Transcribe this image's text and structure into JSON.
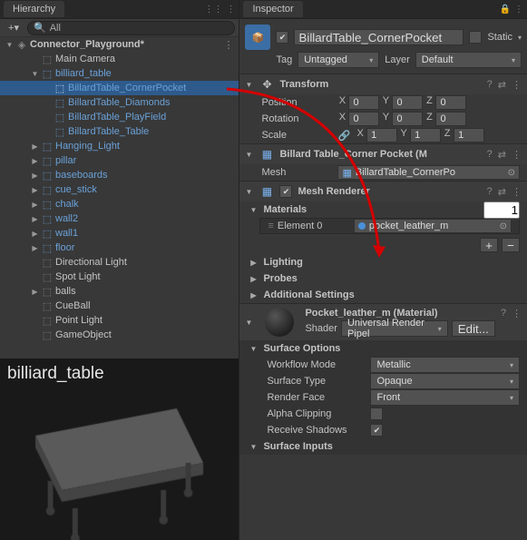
{
  "hierarchy": {
    "tab": "Hierarchy",
    "plus": "+",
    "searchPlaceholder": "All",
    "scene": {
      "name": "Connector_Playground*"
    },
    "nodes": [
      {
        "depth": 2,
        "label": "Main Camera",
        "blue": false,
        "fold": "none"
      },
      {
        "depth": 2,
        "label": "billiard_table",
        "blue": true,
        "fold": "open"
      },
      {
        "depth": 3,
        "label": "BillardTable_CornerPocket",
        "blue": true,
        "fold": "none",
        "sel": true
      },
      {
        "depth": 3,
        "label": "BillardTable_Diamonds",
        "blue": true,
        "fold": "none"
      },
      {
        "depth": 3,
        "label": "BillardTable_PlayField",
        "blue": true,
        "fold": "none"
      },
      {
        "depth": 3,
        "label": "BillardTable_Table",
        "blue": true,
        "fold": "none"
      },
      {
        "depth": 2,
        "label": "Hanging_Light",
        "blue": true,
        "fold": "closed"
      },
      {
        "depth": 2,
        "label": "pillar",
        "blue": true,
        "fold": "closed"
      },
      {
        "depth": 2,
        "label": "baseboards",
        "blue": true,
        "fold": "closed"
      },
      {
        "depth": 2,
        "label": "cue_stick",
        "blue": true,
        "fold": "closed"
      },
      {
        "depth": 2,
        "label": "chalk",
        "blue": true,
        "fold": "closed"
      },
      {
        "depth": 2,
        "label": "wall2",
        "blue": true,
        "fold": "closed"
      },
      {
        "depth": 2,
        "label": "wall1",
        "blue": true,
        "fold": "closed"
      },
      {
        "depth": 2,
        "label": "floor",
        "blue": true,
        "fold": "closed"
      },
      {
        "depth": 2,
        "label": "Directional Light",
        "blue": false,
        "fold": "none"
      },
      {
        "depth": 2,
        "label": "Spot Light",
        "blue": false,
        "fold": "none"
      },
      {
        "depth": 2,
        "label": "balls",
        "blue": false,
        "fold": "closed"
      },
      {
        "depth": 2,
        "label": "CueBall",
        "blue": false,
        "fold": "none"
      },
      {
        "depth": 2,
        "label": "Point Light",
        "blue": false,
        "fold": "none"
      },
      {
        "depth": 2,
        "label": "GameObject",
        "blue": false,
        "fold": "none"
      }
    ]
  },
  "preview": {
    "title": "billiard_table"
  },
  "inspector": {
    "tab": "Inspector",
    "header": {
      "name": "BillardTable_CornerPocket",
      "active": true,
      "staticLabel": "Static",
      "tagLabel": "Tag",
      "tagValue": "Untagged",
      "layerLabel": "Layer",
      "layerValue": "Default"
    },
    "transform": {
      "title": "Transform",
      "rows": [
        {
          "label": "Position",
          "x": "0",
          "y": "0",
          "z": "0"
        },
        {
          "label": "Rotation",
          "x": "0",
          "y": "0",
          "z": "0"
        },
        {
          "label": "Scale",
          "x": "1",
          "y": "1",
          "z": "1",
          "link": true
        }
      ]
    },
    "meshFilter": {
      "title": "Billard Table_Corner Pocket (M",
      "meshLabel": "Mesh",
      "meshValue": "BillardTable_CornerPo"
    },
    "meshRenderer": {
      "title": "Mesh Renderer",
      "materialsLabel": "Materials",
      "materialsCount": "1",
      "element0Label": "Element 0",
      "element0Value": "pocket_leather_m",
      "lighting": "Lighting",
      "probes": "Probes",
      "additional": "Additional Settings"
    },
    "material": {
      "title": "Pocket_leather_m (Material)",
      "shaderLabel": "Shader",
      "shaderValue": "Universal Render Pipel",
      "editBtn": "Edit...",
      "surfaceOptions": "Surface Options",
      "props": [
        {
          "label": "Workflow Mode",
          "value": "Metallic",
          "type": "dropdown"
        },
        {
          "label": "Surface Type",
          "value": "Opaque",
          "type": "dropdown"
        },
        {
          "label": "Render Face",
          "value": "Front",
          "type": "dropdown"
        },
        {
          "label": "Alpha Clipping",
          "value": false,
          "type": "check"
        },
        {
          "label": "Receive Shadows",
          "value": true,
          "type": "check"
        }
      ],
      "surfaceInputs": "Surface Inputs"
    }
  }
}
